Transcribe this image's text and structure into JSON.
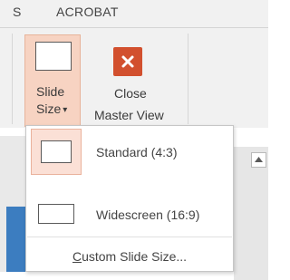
{
  "ribbon_tabs": [
    "S",
    "ACROBAT"
  ],
  "slide_size_button": {
    "line1": "Slide",
    "line2": "Size",
    "arrow": "▾"
  },
  "close_master_button": {
    "line1": "Close",
    "line2": "Master View"
  },
  "dropdown": {
    "items": [
      {
        "label": "Standard (4:3)",
        "selected": true
      },
      {
        "label": "Widescreen (16:9)",
        "selected": false
      }
    ],
    "custom_prefix": "C",
    "custom_rest": "ustom Slide Size..."
  },
  "colors": {
    "accent": "#d2502e",
    "highlight": "#f7d3c2",
    "highlight_border": "#e7b49b"
  }
}
